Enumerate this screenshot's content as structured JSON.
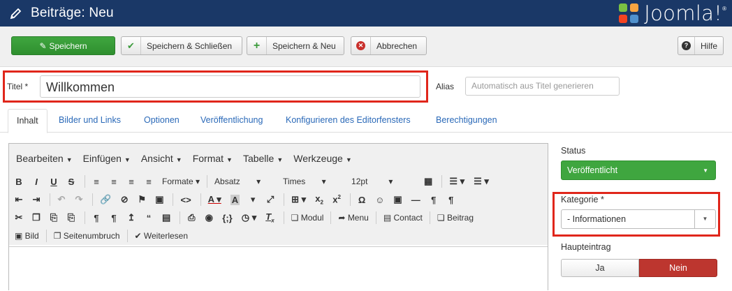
{
  "header": {
    "title": "Beiträge: Neu",
    "logo_text": "Joomla!",
    "reg_mark": "®",
    "bg_color": "#1a3867"
  },
  "toolbar": {
    "save": "Speichern",
    "save_close": "Speichern & Schließen",
    "save_new": "Speichern & Neu",
    "cancel": "Abbrechen",
    "help": "Hilfe"
  },
  "form": {
    "title_label": "Titel *",
    "title_value": "Willkommen",
    "alias_label": "Alias",
    "alias_placeholder": "Automatisch aus Titel generieren"
  },
  "tabs": [
    "Inhalt",
    "Bilder und Links",
    "Optionen",
    "Veröffentlichung",
    "Konfigurieren des Editorfensters",
    "Berechtigungen"
  ],
  "editor": {
    "menus": [
      "Bearbeiten",
      "Einfügen",
      "Ansicht",
      "Format",
      "Tabelle",
      "Werkzeuge"
    ],
    "formats_dd": "Formate",
    "block_dd": "Absatz",
    "font_dd": "Times",
    "size_dd": "12pt",
    "btn_modul": "Modul",
    "btn_menu": "Menu",
    "btn_contact": "Contact",
    "btn_beitrag": "Beitrag",
    "btn_bild": "Bild",
    "btn_seitenumbruch": "Seitenumbruch",
    "btn_weiterlesen": "Weiterlesen"
  },
  "sidebar": {
    "status_label": "Status",
    "status_value": "Veröffentlicht",
    "category_label": "Kategorie *",
    "category_value": "- Informationen",
    "featured_label": "Haupteintrag",
    "featured_yes": "Ja",
    "featured_no": "Nein"
  },
  "colors": {
    "accent_green": "#3fa63f",
    "highlight_red": "#e0261b",
    "nein_red": "#bd362f",
    "link_blue": "#2a69b8"
  }
}
